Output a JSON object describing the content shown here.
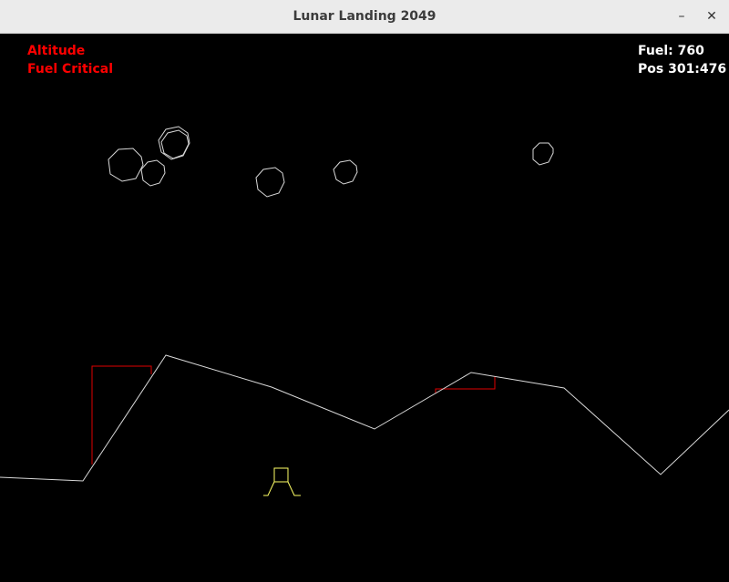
{
  "window": {
    "title": "Lunar Landing 2049",
    "minimize_glyph": "–",
    "close_glyph": "✕"
  },
  "hud": {
    "warning_altitude": "Altitude",
    "warning_fuel": "Fuel Critical",
    "fuel": "Fuel: 760",
    "position": "Pos 301:476"
  },
  "colors": {
    "background": "#000000",
    "terrain": "#d8d8d8",
    "asteroid": "#d8d8d8",
    "landing_pad": "#e00000",
    "lander": "#ffff66",
    "warning_text": "#ff0000",
    "info_text": "#ffffff"
  },
  "icons": {
    "minimize": "minimize-icon",
    "close": "close-icon"
  }
}
